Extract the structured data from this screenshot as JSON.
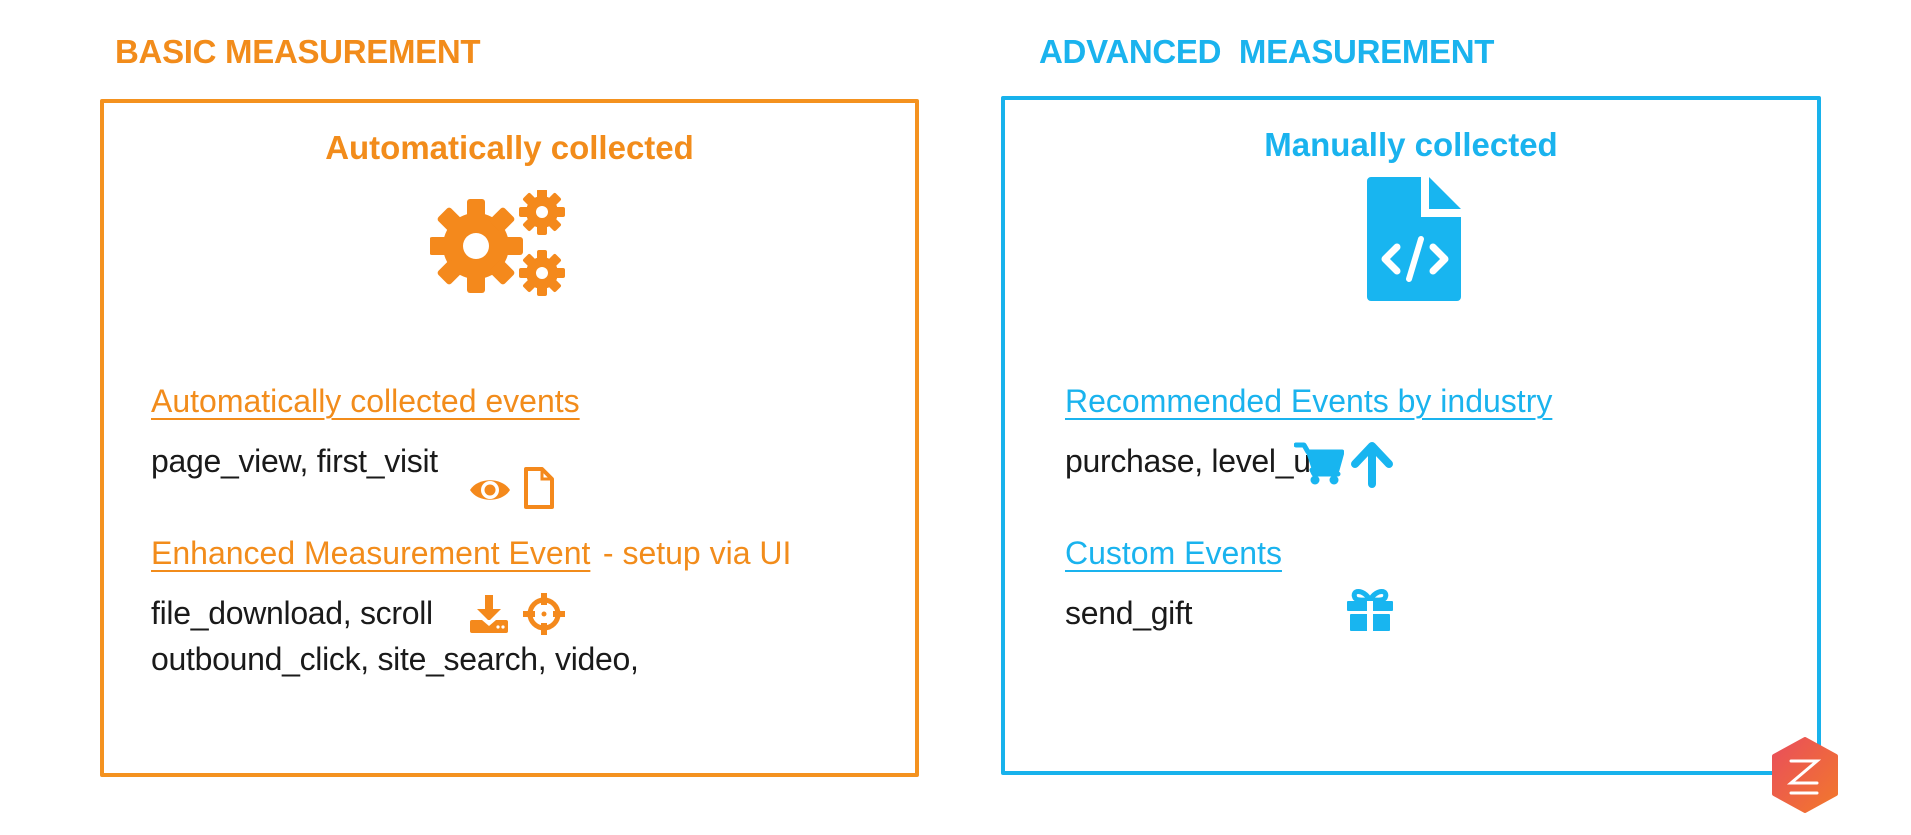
{
  "colors": {
    "basic": "#F28C1B",
    "advanced": "#1AB3EE",
    "text": "#1a1a1a",
    "logo_start": "#E94E5B",
    "logo_end": "#F2782C"
  },
  "basic": {
    "heading": "BASIC MEASUREMENT",
    "box_title": "Automatically collected",
    "main_icon": "gears-icon",
    "sections": [
      {
        "link": "Automatically collected events",
        "suffix": "",
        "lines": [
          "page_view, first_visit"
        ],
        "icons": [
          "eye-icon",
          "file-icon"
        ]
      },
      {
        "link": "Enhanced Measurement Event",
        "suffix": " - setup via UI",
        "lines": [
          "file_download, scroll",
          "outbound_click, site_search, video,"
        ],
        "icons": [
          "download-icon",
          "crosshair-icon"
        ]
      }
    ]
  },
  "advanced": {
    "heading": "ADVANCED  MEASUREMENT",
    "box_title": "Manually collected",
    "main_icon": "code-file-icon",
    "sections": [
      {
        "link": "Recommended Events by industry",
        "suffix": "",
        "lines": [
          "purchase, level_up"
        ],
        "icons": [
          "shopping-cart-icon",
          "arrow-up-icon"
        ]
      },
      {
        "link": "Custom Events",
        "suffix": "",
        "lines": [
          "send_gift"
        ],
        "icons": [
          "gift-icon"
        ]
      }
    ]
  },
  "logo": {
    "icon": "hexagon-logo-icon"
  }
}
